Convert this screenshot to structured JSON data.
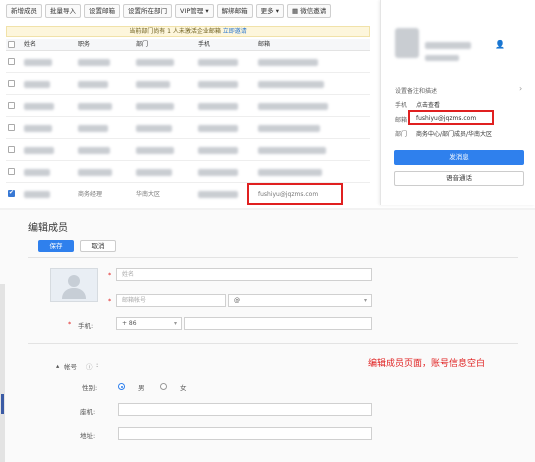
{
  "toolbar": {
    "new_member": "新增成员",
    "bulk_import": "批量导入",
    "set_email": "设置邮箱",
    "set_department": "设置所在部门",
    "vip_manage": "VIP管理",
    "unbind_email": "解绑邮箱",
    "more": "更多",
    "wechat_invite": "微信邀请"
  },
  "notice": {
    "text": "当前部门尚有 1 人未激活企业邮箱",
    "link": "立即邀请"
  },
  "table": {
    "headers": [
      "姓名",
      "职务",
      "部门",
      "手机",
      "邮箱"
    ],
    "selected_row": {
      "position": "商务经理",
      "department": "华南大区",
      "email": "fushiyu@jqzms.com"
    }
  },
  "profile": {
    "remark": "设置备注和描述",
    "phone_label": "手机",
    "phone_value": "点击查看",
    "email_label": "邮箱",
    "email_value": "fushiyu@jqzms.com",
    "dept_label": "部门",
    "dept_value": "商务中心/部门成员/华南大区",
    "send_button": "发消息",
    "voice_button": "语音通话"
  },
  "edit": {
    "title": "编辑成员",
    "save": "保存",
    "cancel": "取消",
    "name_placeholder": "姓名",
    "email_placeholder": "邮箱帐号",
    "email_at": "@",
    "phone_label": "手机:",
    "phone_code": "+ 86",
    "account_label": "帐号",
    "gender_label": "性别:",
    "male": "男",
    "female": "女",
    "alias_label": "座机:",
    "address_label": "地址:"
  },
  "annotation": "编辑成员页面，账号信息空白",
  "colors": {
    "accent": "#2f80ed",
    "highlight": "#e02020"
  }
}
